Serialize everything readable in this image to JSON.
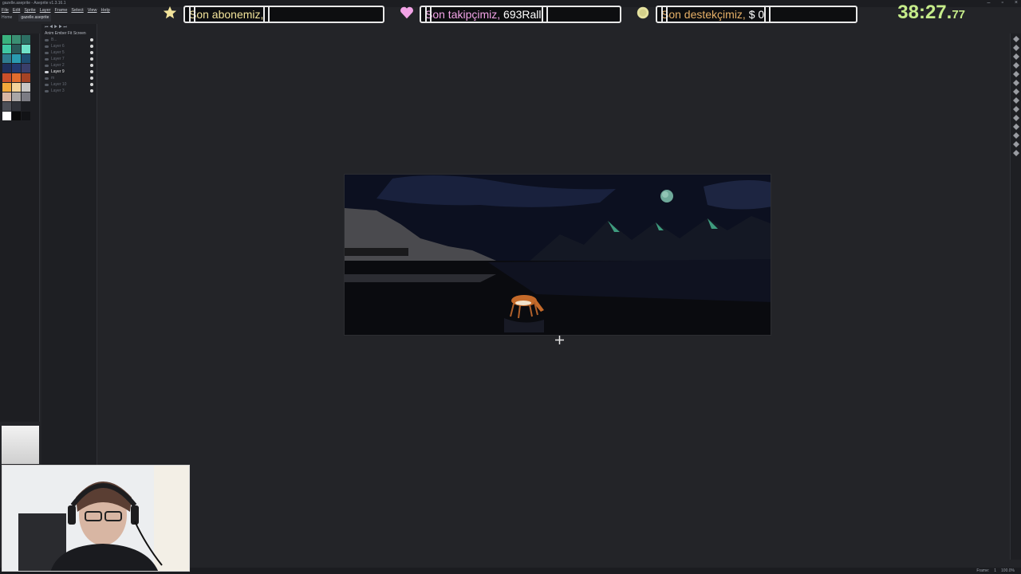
{
  "app": {
    "title": "gazelle.aseprite - Aseprite v1.3.16.1",
    "menu": [
      "File",
      "Edit",
      "Sprite",
      "Layer",
      "Frame",
      "Select",
      "View",
      "Help"
    ],
    "tabs": [
      "Home",
      "gazelle.aseprite"
    ]
  },
  "overlay": {
    "subscriber_label": "Son abonemiz,",
    "subscriber_value": "",
    "follower_label": "Son takipçimiz,",
    "follower_value": "693Rall",
    "donor_label": "Son destekçimiz,",
    "donor_value": "$ 0",
    "timer_main": "38:27.",
    "timer_fraction": "77"
  },
  "layers_panel": {
    "toolbar": "Anim  Ember  Fit Screen",
    "rows": [
      {
        "name": "B...",
        "active": false
      },
      {
        "name": "Layer 6",
        "active": false
      },
      {
        "name": "Layer 5",
        "active": false
      },
      {
        "name": "Layer 7",
        "active": false
      },
      {
        "name": "Layer 2",
        "active": false
      },
      {
        "name": "Layer 9",
        "active": true
      },
      {
        "name": "m",
        "active": false
      },
      {
        "name": "Layer 10",
        "active": false
      },
      {
        "name": "Layer 3",
        "active": false
      }
    ]
  },
  "palette": {
    "colors": [
      "#39b27e",
      "#3a8f73",
      "#2c6e62",
      "#3fc8a3",
      "#2a5b5a",
      "#6fe1c8",
      "#2f7c8f",
      "#2a9bb0",
      "#1e4f73",
      "#1f2f5c",
      "#243a70",
      "#3a3f6a",
      "#c94f2b",
      "#e06d2f",
      "#a54325",
      "#f2a93b",
      "#f3d49b",
      "#c8c6c4",
      "#d9b6a3",
      "#aaa6a6",
      "#7c7c84",
      "#4d4f57",
      "#2f3138",
      "#1c1d22",
      "#ffffff",
      "#0a0a0a",
      "#121316"
    ]
  },
  "statusbar": {
    "frame_label": "Frame:",
    "frame_value": "1",
    "zoom": "100.0%"
  },
  "colors": {
    "accent_timer": "#c6ec8a",
    "overlay_border": "#e8e8e8"
  }
}
